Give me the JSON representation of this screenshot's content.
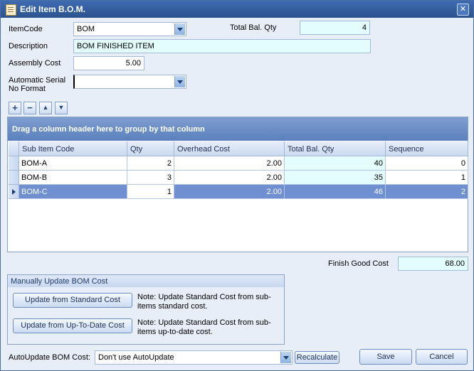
{
  "window": {
    "title": "Edit Item B.O.M."
  },
  "form": {
    "item_code_label": "ItemCode",
    "item_code_value": "BOM",
    "total_bal_qty_label": "Total Bal. Qty",
    "total_bal_qty_value": "4",
    "description_label": "Description",
    "description_value": "BOM FINISHED ITEM",
    "assembly_cost_label": "Assembly Cost",
    "assembly_cost_value": "5.00",
    "serial_label_line1": "Automatic Serial",
    "serial_label_line2": "No Format",
    "serial_value": ""
  },
  "toolbar": {
    "add": "+",
    "remove": "−",
    "up": "▲",
    "down": "▼"
  },
  "grid": {
    "group_hint": "Drag a column header here to group by that column",
    "columns": [
      "Sub Item Code",
      "Qty",
      "Overhead Cost",
      "Total Bal. Qty",
      "Sequence"
    ],
    "rows": [
      {
        "code": "BOM-A",
        "qty": "2",
        "overhead": "2.00",
        "bal": "40",
        "seq": "0"
      },
      {
        "code": "BOM-B",
        "qty": "3",
        "overhead": "2.00",
        "bal": "35",
        "seq": "1"
      },
      {
        "code": "BOM-C",
        "qty": "1",
        "overhead": "2.00",
        "bal": "46",
        "seq": "2"
      }
    ]
  },
  "finish_good": {
    "label": "Finish Good Cost",
    "value": "68.00"
  },
  "manual_update": {
    "title": "Manually Update BOM Cost",
    "std_button": "Update from Standard Cost",
    "std_note_line1": "Note: Update Standard Cost from sub-",
    "std_note_line2": "items standard cost.",
    "utd_button": "Update from Up-To-Date Cost",
    "utd_note_line1": "Note: Update Standard Cost from sub-",
    "utd_note_line2": "items up-to-date cost."
  },
  "footer": {
    "autoupdate_label": "AutoUpdate BOM Cost:",
    "autoupdate_value": "Don't use AutoUpdate",
    "recalculate": "Recalculate",
    "save": "Save",
    "cancel": "Cancel"
  }
}
